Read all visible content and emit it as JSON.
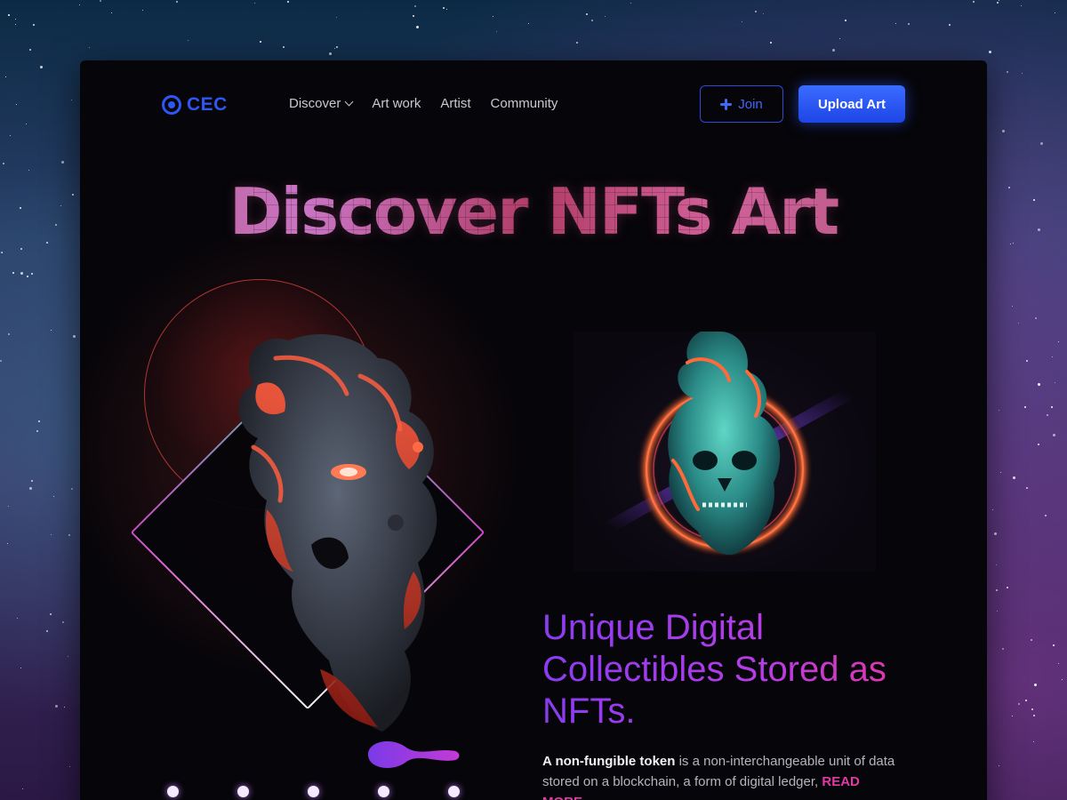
{
  "logo": {
    "text": "CEC"
  },
  "nav": {
    "items": [
      "Discover",
      "Art work",
      "Artist",
      "Community"
    ]
  },
  "actions": {
    "join_label": "Join",
    "upload_label": "Upload Art"
  },
  "hero": {
    "title": "Discover NFTs Art"
  },
  "content": {
    "headline": "Unique Digital Collectibles Stored as NFTs.",
    "para_bold": "A non-fungible token",
    "para_text": " is a non-interchangeable unit of data stored on a blockchain, a form of digital ledger,",
    "read_more": "READ MORE"
  },
  "colors": {
    "brand_blue": "#2f56f2",
    "accent_purple": "#8a3cf2",
    "accent_pink": "#e8379b"
  },
  "carousel": {
    "dot_count": 5
  }
}
